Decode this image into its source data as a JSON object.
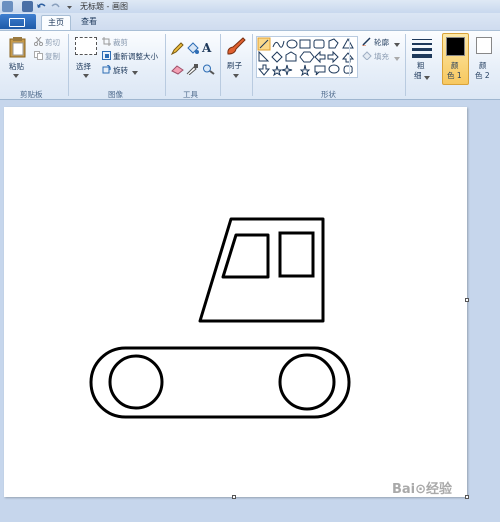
{
  "window": {
    "title": "无标题 - 画图"
  },
  "tabs": [
    {
      "label": "主页"
    },
    {
      "label": "查看"
    }
  ],
  "clipboard": {
    "paste": "粘贴",
    "cut": "剪切",
    "copy": "复制",
    "group": "剪贴板"
  },
  "image": {
    "select": "选择",
    "crop": "裁剪",
    "resize": "重新调整大小",
    "rotate": "旋转",
    "group": "图像"
  },
  "tools": {
    "group": "工具"
  },
  "brushes": {
    "label": "刷子"
  },
  "shapes": {
    "outline": "轮廓",
    "fill": "填充",
    "group": "形状"
  },
  "size": {
    "label1": "粗",
    "label2": "细"
  },
  "colors": {
    "color1_label1": "颜",
    "color1_label2": "色 1",
    "color2_label1": "颜",
    "color2_label2": "色 2",
    "color1_value": "#000000",
    "color2_value": "#ffffff"
  },
  "watermark": {
    "text": "Bai⊙经验"
  }
}
